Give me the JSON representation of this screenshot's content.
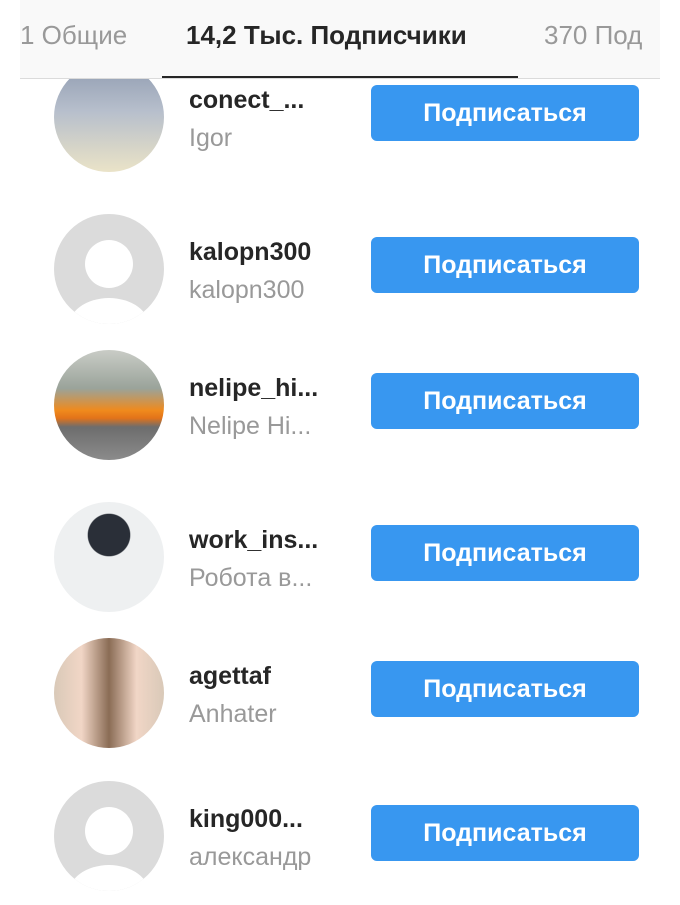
{
  "tabs": [
    {
      "label": "1 Общие",
      "active": false
    },
    {
      "label": "14,2 Тыс. Подписчики",
      "active": true
    },
    {
      "label": "370 Под",
      "active": false
    }
  ],
  "follow_label": "Подписаться",
  "users": [
    {
      "username": "conect_...",
      "fullname": "Igor",
      "avatar": "sky-photo"
    },
    {
      "username": "kalopn300",
      "fullname": "kalopn300",
      "avatar": "default"
    },
    {
      "username": "nelipe_hi...",
      "fullname": "Nelipe Hi...",
      "avatar": "orange-car-photo"
    },
    {
      "username": "work_ins...",
      "fullname": "Робота в...",
      "avatar": "desk-photo"
    },
    {
      "username": "agettaf",
      "fullname": "Anhater",
      "avatar": "girl-photo"
    },
    {
      "username": "king000...",
      "fullname": "александр",
      "avatar": "default"
    }
  ],
  "colors": {
    "accent": "#3897f0",
    "text": "#262626",
    "muted": "#999999"
  }
}
